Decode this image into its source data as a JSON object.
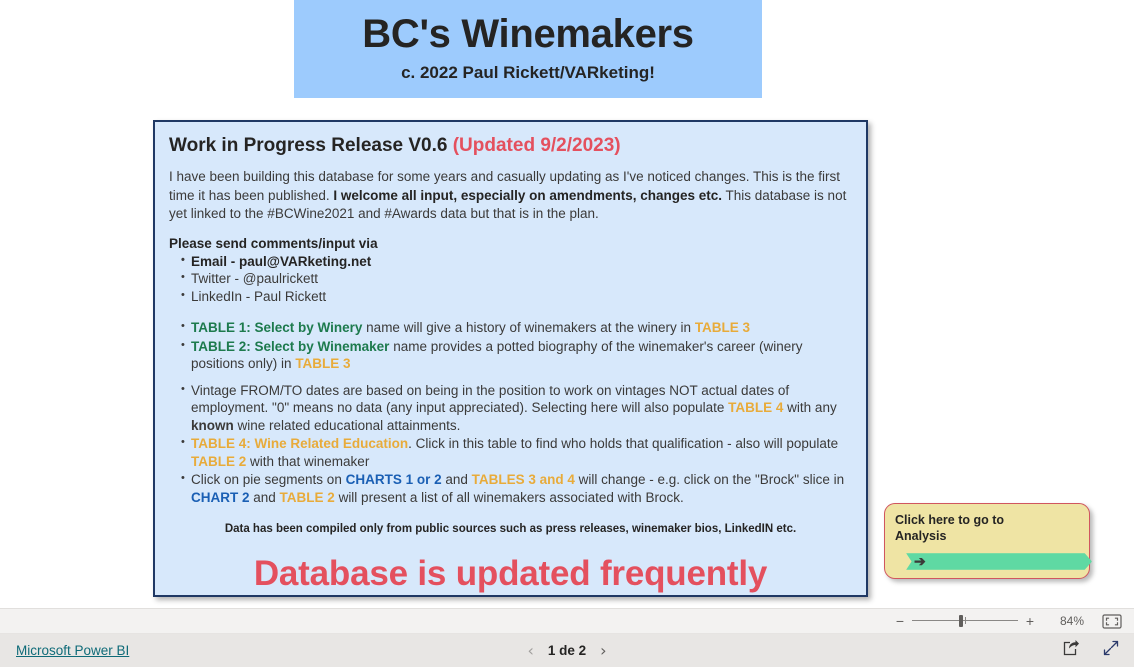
{
  "banner": {
    "title": "BC's Winemakers",
    "subtitle": "c. 2022 Paul Rickett/VARketing!"
  },
  "card": {
    "heading_main": "Work in Progress Release V0.6",
    "heading_updated": "(Updated 9/2/2023)",
    "intro_part1": "I have been building this database for some years and casually updating as I've noticed changes. This is the first time it has been published. ",
    "intro_bold": "I welcome all input, especially on amendments, changes etc.",
    "intro_part2": "  This database is not yet linked to the #BCWine2021 and #Awards data but that is in the plan.",
    "contact_heading": "Please send comments/input via",
    "contact_items": [
      {
        "label": "Email",
        "sep": " - ",
        "value": "paul@VARketing.net",
        "bold": true
      },
      {
        "label": "Twitter",
        "sep": " - ",
        "value": "@paulrickett",
        "bold": false
      },
      {
        "label": "LinkedIn",
        "sep": " - ",
        "value": "Paul Rickett",
        "bold": false
      }
    ],
    "bullet_table1": {
      "green": "TABLE 1: Select by Winery",
      "mid": " name will give a history of winemakers at the winery in ",
      "gold": "TABLE 3"
    },
    "bullet_table2": {
      "green": "TABLE  2: Select by Winemaker",
      "mid": " name provides a potted biography of the winemaker's career (winery positions only) in ",
      "gold": "TABLE 3"
    },
    "bullet_vintage": {
      "part1": "Vintage FROM/TO dates are based on being in the position to work on vintages NOT actual dates of employment. \"0\" means no data (any input appreciated). Selecting here will also populate ",
      "gold": "TABLE 4",
      "part2": " with any ",
      "bold": "known",
      "part3": " wine related educational attainments."
    },
    "bullet_table4": {
      "gold1": "TABLE 4: Wine Related Education",
      "part1": ". Click in this table to find who holds that qualification - also will populate ",
      "gold2": "TABLE 2",
      "part2": " with that winemaker"
    },
    "bullet_pie": {
      "part1": "Click on pie segments on ",
      "blue1": "CHARTS 1 or 2",
      "part2": " and ",
      "gold1": "TABLES 3 and 4",
      "part3": " will change - e.g. click on the \"Brock\" slice in ",
      "blue2": "CHART 2",
      "part4": " and ",
      "gold2": "TABLE 2",
      "part5": " will present a list of all winemakers associated with Brock."
    },
    "footnote": "Data has been compiled only from public sources such as press releases, winemaker bios, LinkedIN etc.",
    "big_red": "Database is updated frequently"
  },
  "analysis_button": {
    "label_line1": "Click here to go to",
    "label_line2": "Analysis",
    "arrow_glyph": "➔",
    "arrow_color": "#5fd9a3",
    "card_color": "#efe4a4",
    "border_color": "#d0565f"
  },
  "zoom_bar": {
    "minus": "−",
    "plus": "+",
    "level": "84%",
    "fit_icon": "fit-to-page-icon"
  },
  "footer": {
    "brand": "Microsoft Power BI",
    "prev": "‹",
    "next": "›",
    "page_text": "1 de 2",
    "share_icon": "share-icon",
    "fullscreen_icon": "fullscreen-icon"
  },
  "colors": {
    "banner_blue": "#9dcbfd",
    "card_blue": "#d7e8fb",
    "card_border": "#1f3864",
    "accent_red": "#e4505e",
    "accent_green": "#1d7a4d",
    "accent_gold": "#e8ab3a",
    "accent_blue": "#1a5fb4",
    "link_teal": "#0f6b78"
  }
}
